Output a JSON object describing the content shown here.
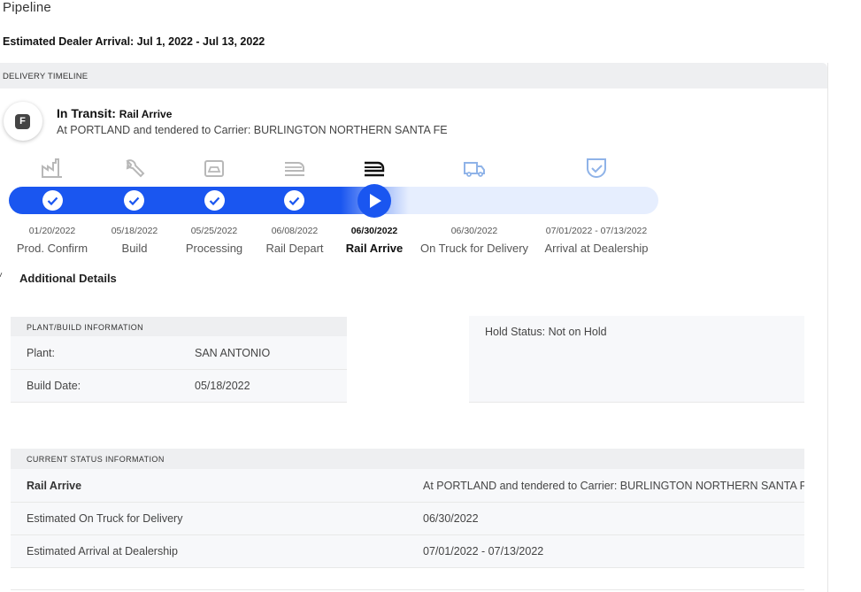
{
  "page": {
    "title": "Pipeline",
    "estimated_arrival": "Estimated Dealer Arrival: Jul 1, 2022 - Jul 13, 2022"
  },
  "timeline": {
    "header": "DELIVERY TIMELINE",
    "badge_letter": "F",
    "status_main": "In Transit:",
    "status_sub": "Rail Arrive",
    "status_desc": "At PORTLAND and tendered to Carrier: BURLINGTON NORTHERN SANTA FE",
    "accent_color": "#1a56f0",
    "current_step_index": 4,
    "steps": [
      {
        "date": "01/20/2022",
        "label": "Prod. Confirm",
        "icon": "factory-icon",
        "done": true
      },
      {
        "date": "05/18/2022",
        "label": "Build",
        "icon": "wrench-icon",
        "done": true
      },
      {
        "date": "05/25/2022",
        "label": "Processing",
        "icon": "car-processing-icon",
        "done": true
      },
      {
        "date": "06/08/2022",
        "label": "Rail Depart",
        "icon": "rail-depart-icon",
        "done": true
      },
      {
        "date": "06/30/2022",
        "label": "Rail Arrive",
        "icon": "rail-arrive-icon",
        "done": false
      },
      {
        "date": "06/30/2022",
        "label": "On Truck for Delivery",
        "icon": "truck-icon",
        "done": false
      },
      {
        "date": "07/01/2022 - 07/13/2022",
        "label": "Arrival at Dealership",
        "icon": "shield-check-icon",
        "done": false
      }
    ]
  },
  "additional_details": {
    "toggle_label": "Additional Details",
    "plant_card": {
      "header": "PLANT/BUILD INFORMATION",
      "rows": [
        {
          "label": "Plant:",
          "value": "SAN ANTONIO"
        },
        {
          "label": "Build Date:",
          "value": "05/18/2022"
        }
      ]
    },
    "hold_card": {
      "text": "Hold Status: Not on Hold"
    },
    "current_status_card": {
      "header": "CURRENT STATUS INFORMATION",
      "rows": [
        {
          "label": "Rail Arrive",
          "value": "At PORTLAND and tendered to Carrier: BURLINGTON NORTHERN SANTA FE"
        },
        {
          "label": "Estimated On Truck for Delivery",
          "value": "06/30/2022"
        },
        {
          "label": "Estimated Arrival at Dealership",
          "value": "07/01/2022 - 07/13/2022"
        }
      ]
    }
  }
}
